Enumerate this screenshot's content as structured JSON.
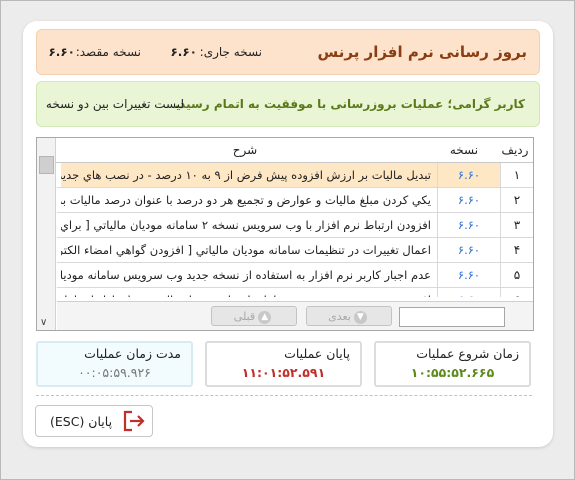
{
  "header": {
    "title": "بروز رسانی نرم افزار پرنس",
    "current_version_label": "نسخه جاری:",
    "current_version": "۶.۶۰",
    "target_version_label": "نسخه مقصد:",
    "target_version": "۶.۶۰"
  },
  "message": {
    "text": "کاربر گرامی؛ عملیات بروزرسانی با  موفقیت به اتمام رسید.",
    "changes_link": "لیست تغییرات بین دو نسخه"
  },
  "grid": {
    "columns": {
      "row": "ردیف",
      "version": "نسخه",
      "description": "شرح"
    },
    "rows": [
      {
        "num": "۱",
        "version": "۶.۶۰",
        "description": "تبدیل مالیات بر ارزش افزوده پیش فرض از ۹ به ۱۰ درصد - در نصب هاي جدید نرم افزار"
      },
      {
        "num": "۲",
        "version": "۶.۶۰",
        "description": "یکي کردن مبلغ مالیات و عوارض و تجمیع هر دو درصد با عنوان درصد مالیات بر ارزش"
      },
      {
        "num": "۳",
        "version": "۶.۶۰",
        "description": "افزودن ارتباط نرم افزار با وب سرویس نسخه ۲ سامانه مودیان مالیاتي [ براي استفاده از"
      },
      {
        "num": "۴",
        "version": "۶.۶۰",
        "description": "اعمال تغییرات در تنظیمات سامانه مودیان مالیاتي [ افزودن گواهي امضاء الکترونیکي و"
      },
      {
        "num": "۵",
        "version": "۶.۶۰",
        "description": "عدم اجبار کاربر نرم افزار به استفاده از نسخه جدید وب سرویس سامانه مودیان مالیاتي"
      },
      {
        "num": "۶",
        "version": "۶.۶۰",
        "description": "افزودن نسخه به وب سرویس سامانه امضاء بسته ارسال جهت ارتباط با سامانه مودیان"
      }
    ],
    "selected_index": 0,
    "search_value": "",
    "next_label": "بعدی",
    "prev_label": "قبلی"
  },
  "stats": {
    "start_label": "زمان شروع عملیات",
    "start_value": "۱۰:۵۵:۵۲.۶۶۵",
    "end_label": "پایان عملیات",
    "end_value": "۱۱:۰۱:۵۲.۵۹۱",
    "duration_label": "مدت زمان عملیات",
    "duration_value": "۰۰:۰۵:۵۹.۹۲۶"
  },
  "exit": {
    "label": "پایان (ESC)"
  },
  "colors": {
    "header_bg": "#fde3cc",
    "title": "#8a3d12",
    "message_bg": "#eaf5d6",
    "message_text": "#5a7a1a",
    "selected_row": "#fde7c4",
    "version_link": "#2f6fd0",
    "start_time": "#5e8a1c",
    "end_time": "#c0302b",
    "exit_icon": "#c0302b"
  }
}
